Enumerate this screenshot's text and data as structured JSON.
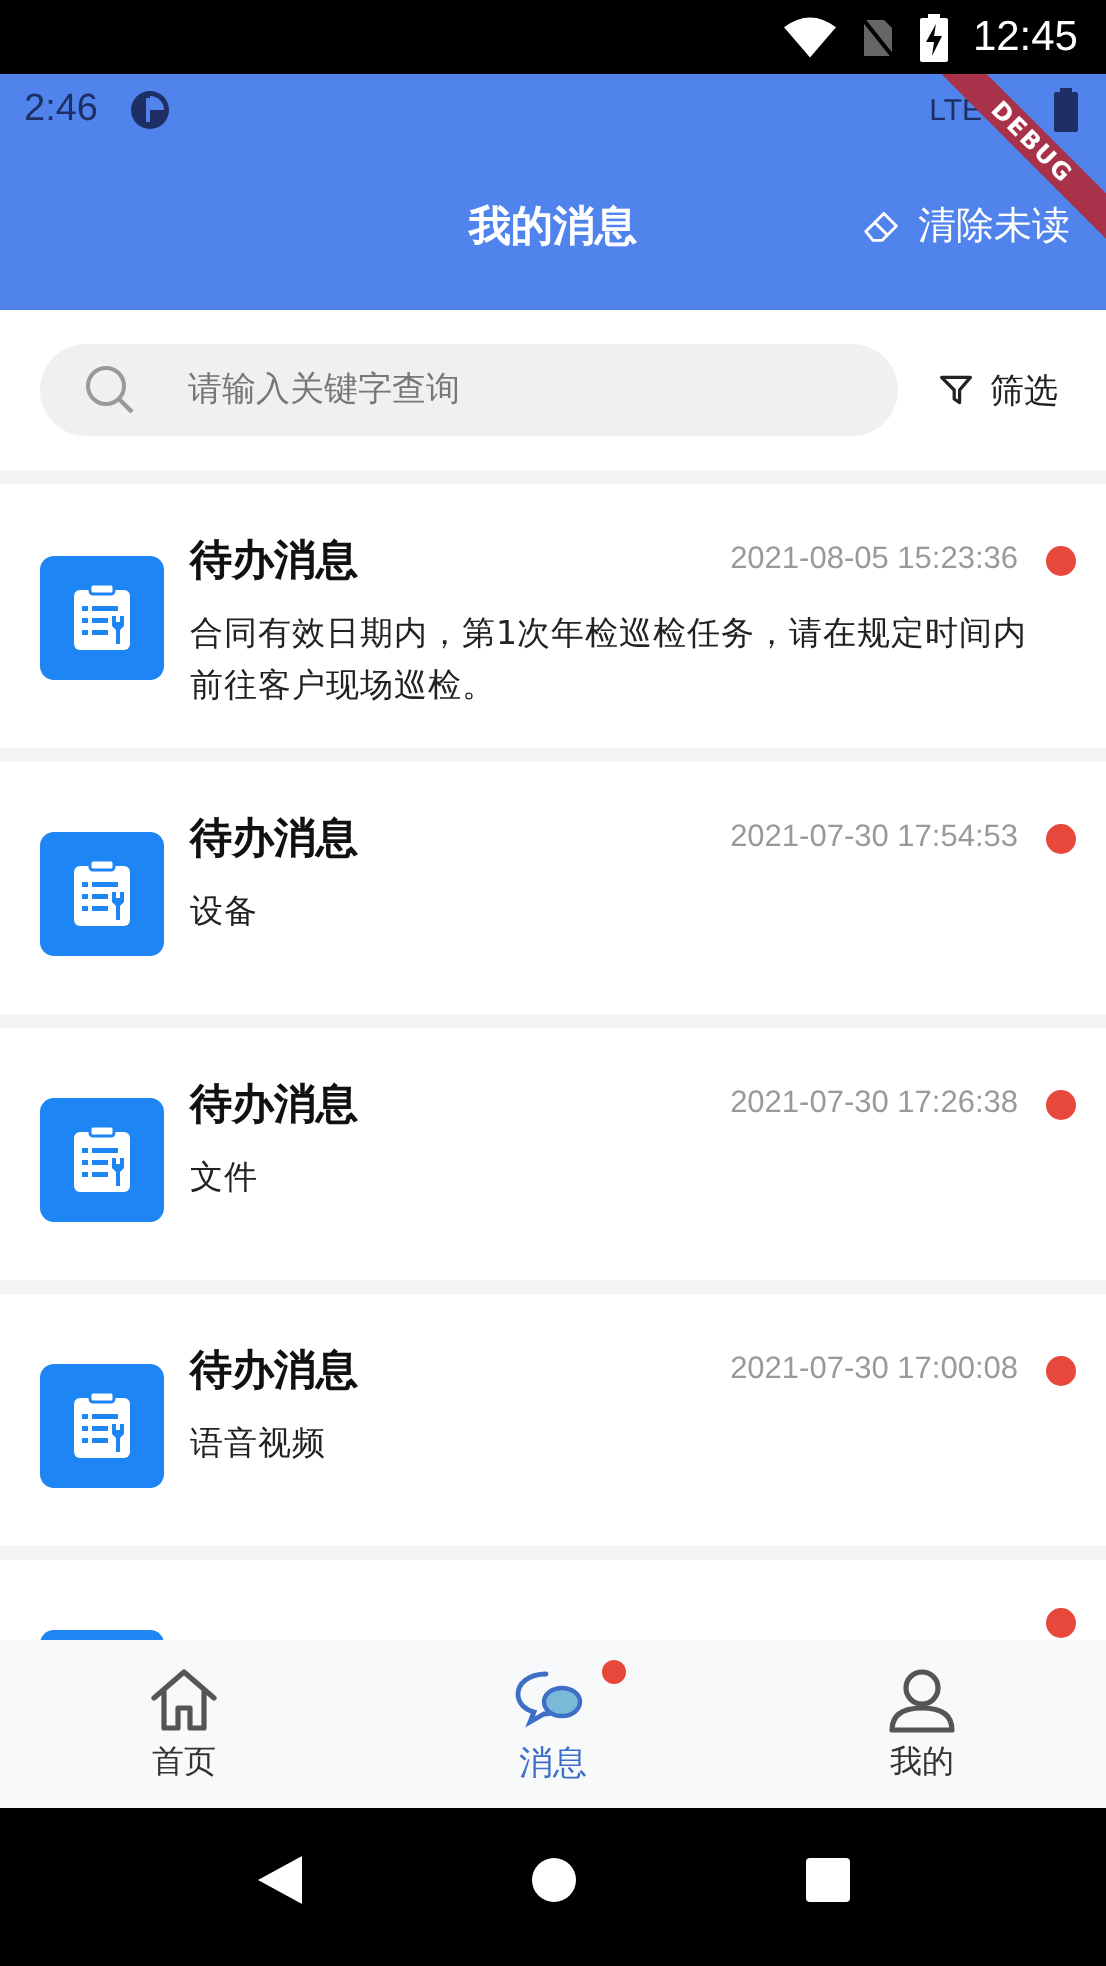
{
  "system_status_bar": {
    "time": "12:45"
  },
  "app_status_bar": {
    "time": "2:46",
    "network": "LTE"
  },
  "debug_banner": "DEBUG",
  "header": {
    "title": "我的消息",
    "action": "清除未读"
  },
  "search": {
    "placeholder": "请输入关键字查询"
  },
  "filter": {
    "label": "筛选"
  },
  "messages": [
    {
      "title": "待办消息",
      "time": "2021-08-05 15:23:36",
      "body": "合同有效日期内，第1次年检巡检任务，请在规定时间内前往客户现场巡检。",
      "unread": true
    },
    {
      "title": "待办消息",
      "time": "2021-07-30 17:54:53",
      "body": "设备",
      "unread": true
    },
    {
      "title": "待办消息",
      "time": "2021-07-30 17:26:38",
      "body": "文件",
      "unread": true
    },
    {
      "title": "待办消息",
      "time": "2021-07-30 17:00:08",
      "body": "语音视频",
      "unread": true
    },
    {
      "unread": true
    }
  ],
  "tabs": [
    {
      "kind": "home",
      "label": "首页",
      "selected": false,
      "badge": false
    },
    {
      "kind": "messages",
      "label": "消息",
      "selected": true,
      "badge": true
    },
    {
      "kind": "profile",
      "label": "我的",
      "selected": false,
      "badge": false
    }
  ]
}
